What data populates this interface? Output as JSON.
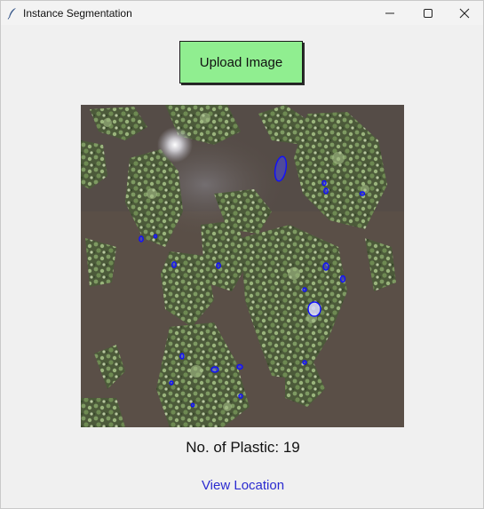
{
  "window": {
    "title": "Instance Segmentation",
    "icon": "feather-icon",
    "controls": [
      "minimize-icon",
      "maximize-icon",
      "close-icon"
    ]
  },
  "upload_button": {
    "label": "Upload Image",
    "color": "#90ee90"
  },
  "result_image": {
    "content": "segmented-aerial-water-photo",
    "mask_color": "#2020ff"
  },
  "count": {
    "text": "No. of Plastic: 19"
  },
  "link": {
    "label": "View Location",
    "color": "#2b2bd0"
  }
}
